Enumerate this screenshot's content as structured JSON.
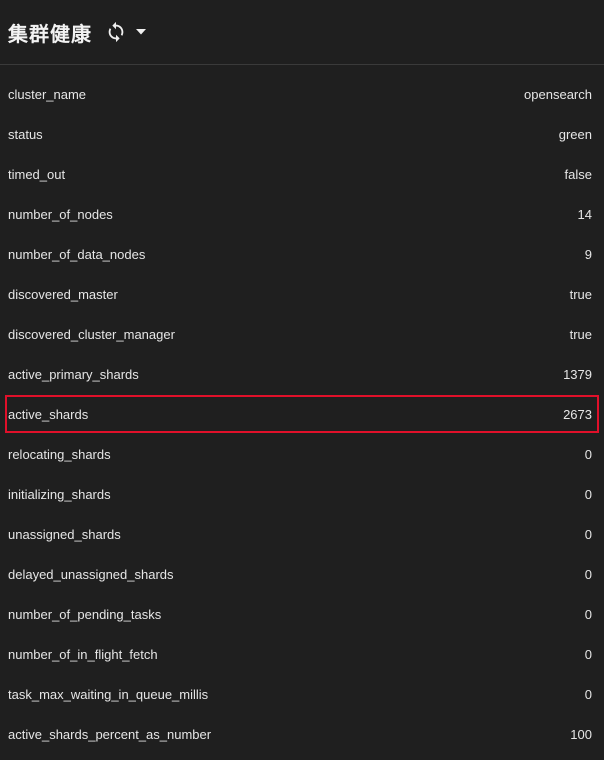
{
  "header": {
    "title": "集群健康"
  },
  "rows": [
    {
      "key": "cluster_name",
      "value": "opensearch"
    },
    {
      "key": "status",
      "value": "green"
    },
    {
      "key": "timed_out",
      "value": "false"
    },
    {
      "key": "number_of_nodes",
      "value": "14"
    },
    {
      "key": "number_of_data_nodes",
      "value": "9"
    },
    {
      "key": "discovered_master",
      "value": "true"
    },
    {
      "key": "discovered_cluster_manager",
      "value": "true"
    },
    {
      "key": "active_primary_shards",
      "value": "1379"
    },
    {
      "key": "active_shards",
      "value": "2673",
      "highlighted": true
    },
    {
      "key": "relocating_shards",
      "value": "0"
    },
    {
      "key": "initializing_shards",
      "value": "0"
    },
    {
      "key": "unassigned_shards",
      "value": "0"
    },
    {
      "key": "delayed_unassigned_shards",
      "value": "0"
    },
    {
      "key": "number_of_pending_tasks",
      "value": "0"
    },
    {
      "key": "number_of_in_flight_fetch",
      "value": "0"
    },
    {
      "key": "task_max_waiting_in_queue_millis",
      "value": "0"
    },
    {
      "key": "active_shards_percent_as_number",
      "value": "100"
    }
  ],
  "colors": {
    "background": "#1f1f1f",
    "highlight_border": "#e0102a",
    "text": "#e6e6e6"
  },
  "icons": {
    "refresh": "refresh-icon",
    "dropdown": "caret-down-icon"
  }
}
